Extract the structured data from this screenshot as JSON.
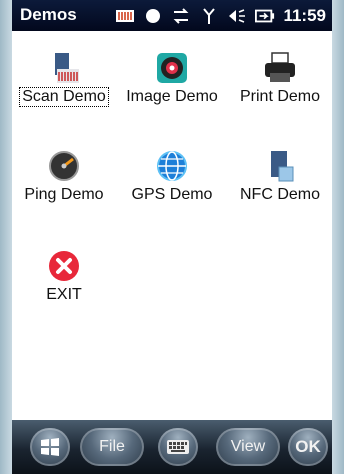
{
  "titlebar": {
    "title": "Demos",
    "time": "11:59"
  },
  "status_icons": [
    "battery-pack-icon",
    "dot-icon",
    "sync-arrows-icon",
    "signal-antenna-icon",
    "volume-icon",
    "charging-battery-icon"
  ],
  "apps": [
    {
      "label": "Scan Demo",
      "icon": "scan-barcode-icon",
      "selected": true
    },
    {
      "label": "Image Demo",
      "icon": "camera-lens-icon"
    },
    {
      "label": "Print Demo",
      "icon": "printer-icon"
    },
    {
      "label": "Ping Demo",
      "icon": "gauge-icon"
    },
    {
      "label": "GPS Demo",
      "icon": "globe-icon"
    },
    {
      "label": "NFC Demo",
      "icon": "nfc-device-icon"
    },
    {
      "label": "EXIT",
      "icon": "exit-x-icon"
    }
  ],
  "softkeys": {
    "start_icon": "windows-flag-icon",
    "file": "File",
    "keyboard_icon": "keyboard-icon",
    "view": "View",
    "ok": "OK"
  }
}
